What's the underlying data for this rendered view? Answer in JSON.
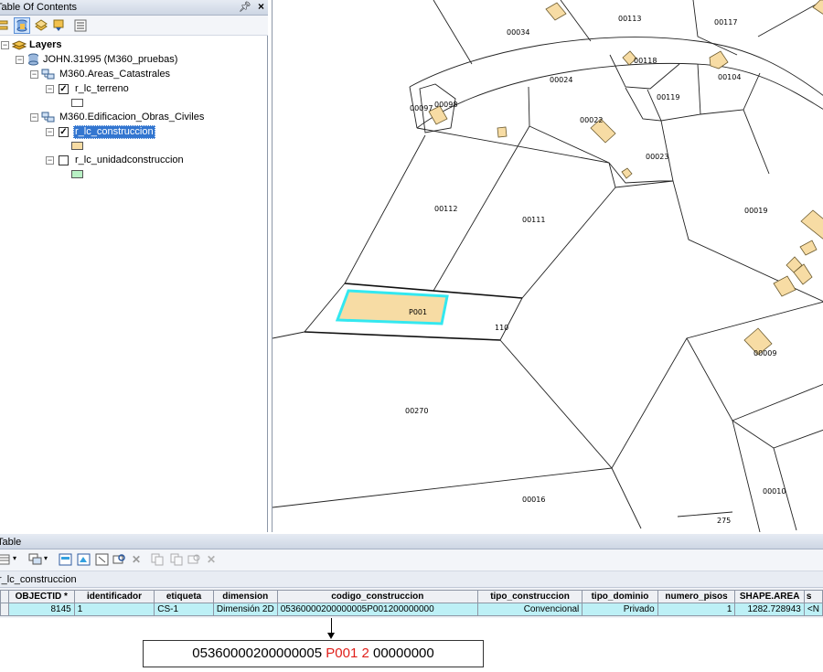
{
  "toc": {
    "title": "Table Of Contents",
    "layers_label": "Layers",
    "dataframe": "JOHN.31995 (M360_pruebas)",
    "group1": "M360.Areas_Catastrales",
    "layer_terreno": "r_lc_terreno",
    "group2": "M360.Edificacion_Obras_Civiles",
    "layer_construccion": "r_lc_construccion",
    "layer_unidad": "r_lc_unidadconstruccion"
  },
  "map": {
    "labels": {
      "l00034": "00034",
      "l00113": "00113",
      "l00117": "00117",
      "l00118": "00118",
      "l00024": "00024",
      "l00104": "00104",
      "l00119": "00119",
      "l00097": "00097",
      "l00098": "00098",
      "l00022": "00022",
      "l00023": "00023",
      "l00112": "00112",
      "l00111": "00111",
      "l00019": "00019",
      "lP001": "P001",
      "l110": "110",
      "l00009": "00009",
      "l00270": "00270",
      "l00016": "00016",
      "l00010": "00010",
      "l275": "275"
    }
  },
  "table": {
    "title": "Table",
    "tab": "r_lc_construccion",
    "columns": [
      "OBJECTID *",
      "identificador",
      "etiqueta",
      "dimension",
      "codigo_construccion",
      "tipo_construccion",
      "tipo_dominio",
      "numero_pisos",
      "SHAPE.AREA",
      "s"
    ],
    "row": {
      "objectid": "8145",
      "identificador": "1",
      "etiqueta": "CS-1",
      "dimension": "Dimensión 2D",
      "codigo": "05360000200000005P001200000000",
      "tipo_construccion": "Convencional",
      "tipo_dominio": "Privado",
      "numero_pisos": "1",
      "shape_area": "1282.728943",
      "extra": "<N"
    }
  },
  "annotation": {
    "part1": "05360000200000005",
    "part2": "P001 2",
    "part3": "00000000"
  },
  "colors": {
    "building_fill": "#f7dca4",
    "selection": "#33e8f0",
    "unidad_fill": "#b8f0c4",
    "highlight_text": "#e0201b"
  }
}
